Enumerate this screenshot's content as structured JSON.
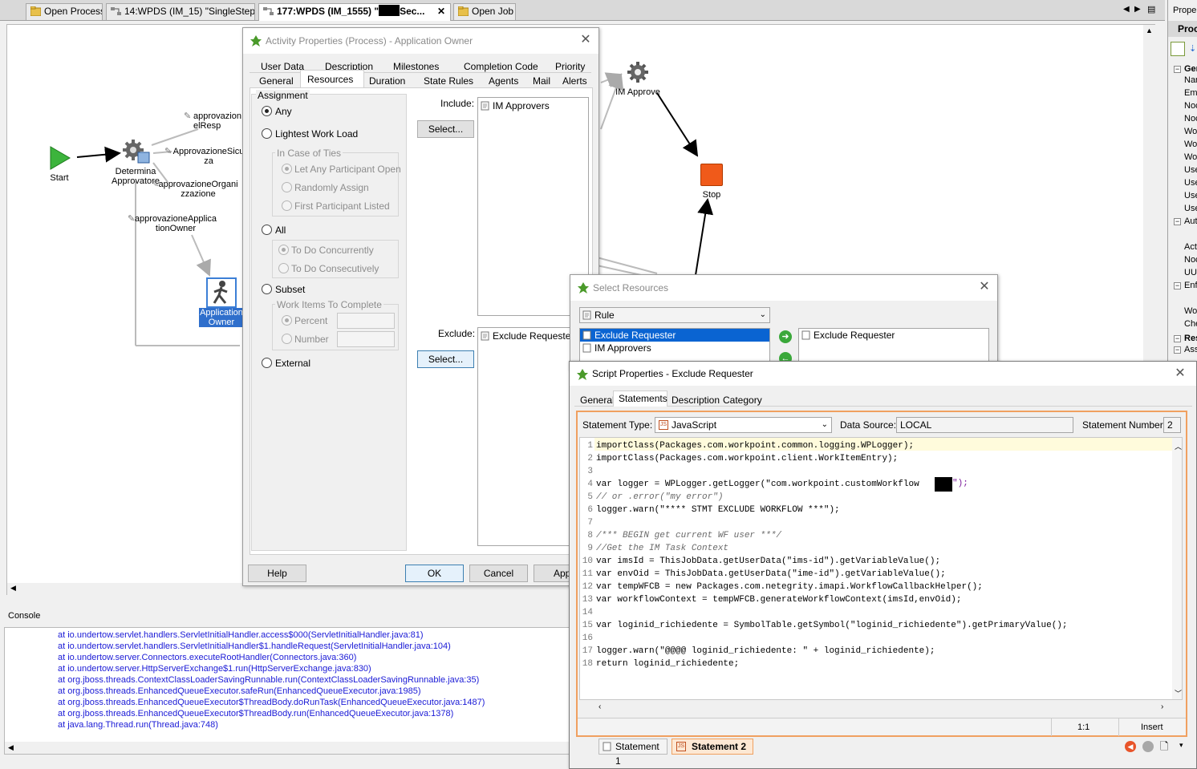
{
  "editor_tabs": [
    {
      "label": "Open Process"
    },
    {
      "label": "14:WPDS (IM_15) \"SingleStep..."
    },
    {
      "label": "177:WPDS (IM_1555) \"",
      "suffix": "Sec...",
      "active": true
    },
    {
      "label": "Open Job"
    }
  ],
  "diagram": {
    "nodes": {
      "start": "Start",
      "determina": "Determina\nApprovatore",
      "application_owner": "Application\nOwner",
      "im_approve": "IM Approve",
      "stop": "Stop"
    },
    "rules": {
      "r1": "approvazion\nelResp",
      "r2": "ApprovazioneSicu\nza",
      "r3": "approvazioneOrgani\nzzazione",
      "r4": "approvazioneApplica\ntionOwner"
    }
  },
  "activity_dialog": {
    "title": "Activity Properties (Process) - Application Owner",
    "tabs_row1": [
      "User Data",
      "Description",
      "Milestones",
      "Completion Code",
      "Priority"
    ],
    "tabs_row2": [
      "General",
      "Resources",
      "Duration",
      "State Rules",
      "Agents",
      "Mail",
      "Alerts"
    ],
    "active_tab": "Resources",
    "assignment_label": "Assignment",
    "any": "Any",
    "lightest": "Lightest Work Load",
    "in_case_of_ties": "In Case of Ties",
    "let_any": "Let Any Participant Open",
    "randomly": "Randomly Assign",
    "first_participant": "First Participant Listed",
    "all": "All",
    "concurrently": "To Do Concurrently",
    "consecutively": "To Do Consecutively",
    "subset": "Subset",
    "work_items": "Work Items To Complete",
    "percent": "Percent",
    "number": "Number",
    "external": "External",
    "include_label": "Include:",
    "exclude_label": "Exclude:",
    "select_btn": "Select...",
    "include_items": [
      "IM Approvers"
    ],
    "exclude_items": [
      "Exclude Requester"
    ],
    "help_btn": "Help",
    "ok_btn": "OK",
    "cancel_btn": "Cancel",
    "apply_btn": "App"
  },
  "select_dialog": {
    "title": "Select Resources",
    "dropdown": "Rule",
    "available": [
      "Exclude Requester",
      "IM Approvers"
    ],
    "selected": [
      "Exclude Requester"
    ]
  },
  "script_dialog": {
    "title": "Script Properties - Exclude Requester",
    "tabs": [
      "General",
      "Statements",
      "Description",
      "Category"
    ],
    "active_tab": "Statements",
    "statement_type_label": "Statement Type:",
    "statement_type": "JavaScript",
    "data_source_label": "Data Source:",
    "data_source": "LOCAL",
    "statement_number_label": "Statement Number:",
    "statement_number": "2",
    "code_lines": [
      "importClass(Packages.com.workpoint.common.logging.WPLogger);",
      "importClass(Packages.com.workpoint.client.WorkItemEntry);",
      "",
      "var logger = WPLogger.getLogger(\"com.workpoint.customWorkflow",
      "// or .error(\"my error\")",
      "logger.warn(\"**** STMT EXCLUDE WORKFLOW ***\");",
      "",
      "/*** BEGIN get current WF user ***/",
      "//Get the IM Task Context",
      "var imsId = ThisJobData.getUserData(\"ims-id\").getVariableValue();",
      "var envOid = ThisJobData.getUserData(\"ime-id\").getVariableValue();",
      "var tempWFCB = new Packages.com.netegrity.imapi.WorkflowCallbackHelper();",
      "var workflowContext = tempWFCB.generateWorkflowContext(imsId,envOid);",
      "",
      "var loginid_richiedente = SymbolTable.getSymbol(\"loginid_richiedente\").getPrimaryValue();",
      "",
      "logger.warn(\"@@@@ loginid_richiedente: \" + loginid_richiedente);",
      "return loginid_richiedente;"
    ],
    "line4_tail": "\");",
    "cursor_pos": "1:1",
    "mode": "Insert",
    "bottom_tabs": [
      "Statement 1",
      "Statement 2"
    ],
    "bottom_active": "Statement 2"
  },
  "console": {
    "title": "Console",
    "lines": [
      "at io.undertow.servlet.handlers.ServletInitialHandler.access$000(ServletInitialHandler.java:81)",
      "at io.undertow.servlet.handlers.ServletInitialHandler$1.handleRequest(ServletInitialHandler.java:104)",
      "at io.undertow.server.Connectors.executeRootHandler(Connectors.java:360)",
      "at io.undertow.server.HttpServerExchange$1.run(HttpServerExchange.java:830)",
      "at org.jboss.threads.ContextClassLoaderSavingRunnable.run(ContextClassLoaderSavingRunnable.java:35)",
      "at org.jboss.threads.EnhancedQueueExecutor.safeRun(EnhancedQueueExecutor.java:1985)",
      "at org.jboss.threads.EnhancedQueueExecutor$ThreadBody.doRunTask(EnhancedQueueExecutor.java:1487)",
      "at org.jboss.threads.EnhancedQueueExecutor$ThreadBody.run(EnhancedQueueExecutor.java:1378)",
      "at java.lang.Thread.run(Thread.java:748)"
    ]
  },
  "properties_panel": {
    "title": "Proper",
    "header": "Proc",
    "items": [
      "Gen",
      "Nan",
      "Emi",
      "Noc",
      "Noc",
      "Wo",
      "Wo",
      "Wo",
      "Use",
      "Use",
      "Use",
      "Use",
      "Aut",
      "Act",
      "Noc",
      "UUI",
      "Enf",
      "Wo",
      "Che",
      "Res",
      "Ass"
    ]
  }
}
